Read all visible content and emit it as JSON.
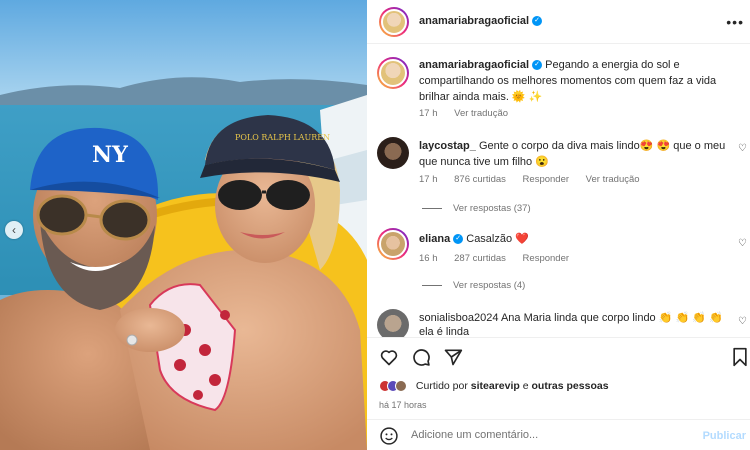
{
  "post": {
    "author": "anamariabragaoficial",
    "more_icon": "more-options-icon"
  },
  "caption": {
    "username": "anamariabragaoficial",
    "text": "Pegando a energia do sol e compartilhando os melhores momentos com quem faz a vida brilhar ainda mais. 🌞 ✨",
    "time": "17 h",
    "translate": "Ver tradução"
  },
  "comments": [
    {
      "username": "laycostap_",
      "text": "Gente o corpo da diva mais lindo😍 😍 que o meu que nunca tive um filho 😮",
      "time": "17 h",
      "likes": "876 curtidas",
      "reply": "Responder",
      "translate": "Ver tradução",
      "replies": "Ver respostas (37)"
    },
    {
      "username": "eliana",
      "text": "Casalzão ❤️",
      "time": "16 h",
      "likes": "287 curtidas",
      "reply": "Responder",
      "replies": "Ver respostas (4)"
    },
    {
      "username": "sonialisboa2024",
      "text": "Ana Maria linda que corpo lindo 👏 👏 👏 👏 ela é linda"
    }
  ],
  "likes": {
    "prefix": "Curtido por ",
    "user": "sitearevip",
    "joiner": " e ",
    "others": "outras pessoas"
  },
  "time_ago": "há 17 horas",
  "add_comment": {
    "placeholder": "Adicione um comentário...",
    "publish": "Publicar"
  },
  "colors": {
    "accent": "#0095f6",
    "text_secondary": "#737373",
    "publish_disabled": "#b3dbff"
  }
}
